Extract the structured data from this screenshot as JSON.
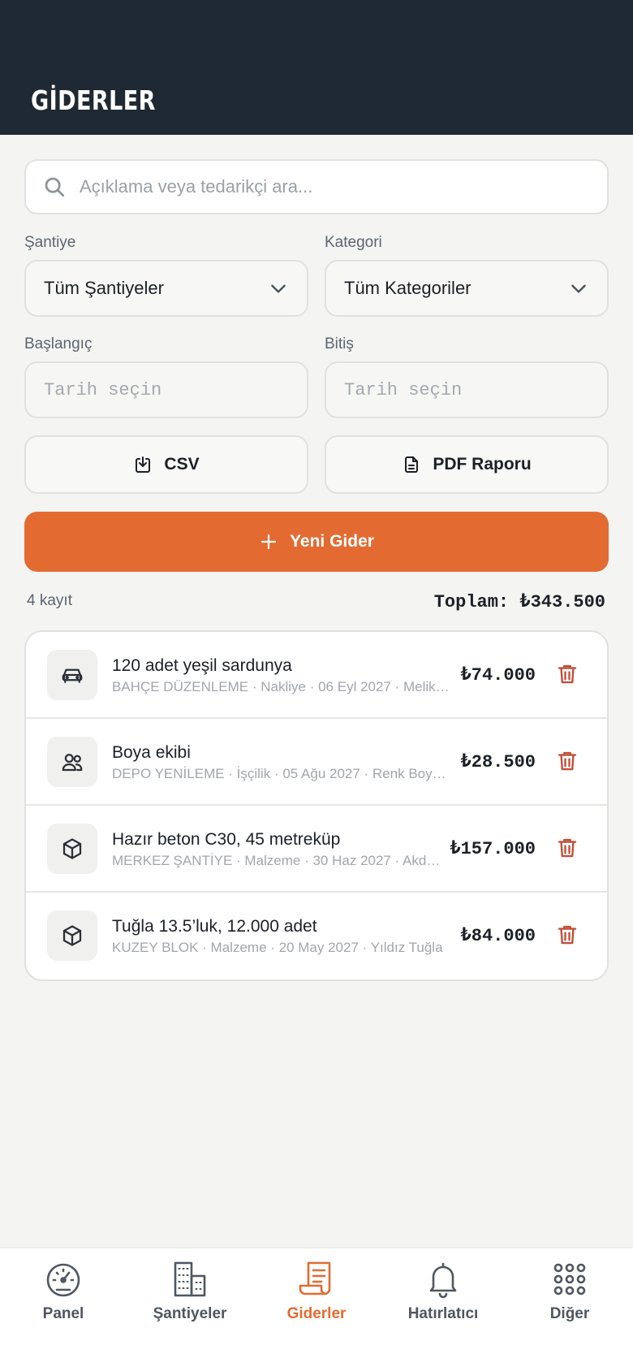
{
  "header": {
    "title": "GİDERLER"
  },
  "search": {
    "placeholder": "Açıklama veya tedarikçi ara..."
  },
  "filters": {
    "site_label": "Şantiye",
    "site_value": "Tüm Şantiyeler",
    "category_label": "Kategori",
    "category_value": "Tüm Kategoriler",
    "start_label": "Başlangıç",
    "start_placeholder": "Tarih seçin",
    "end_label": "Bitiş",
    "end_placeholder": "Tarih seçin"
  },
  "actions": {
    "csv_label": "CSV",
    "pdf_label": "PDF Raporu",
    "new_label": "Yeni Gider"
  },
  "summary": {
    "count": "4 kayıt",
    "total": "Toplam: ₺343.500"
  },
  "expenses": [
    {
      "icon": "car-icon",
      "title": "120 adet yeşil sardunya",
      "meta": "BAHÇE DÜZENLEME · Nakliye · 06 Eyl 2027 · Melik…",
      "amount": "₺74.000"
    },
    {
      "icon": "users-icon",
      "title": "Boya ekibi",
      "meta": "DEPO YENİLEME · İşçilik · 05 Ağu 2027 · Renk Boy…",
      "amount": "₺28.500"
    },
    {
      "icon": "box-icon",
      "title": "Hazır beton C30, 45 metreküp",
      "meta": "MERKEZ ŞANTİYE · Malzeme · 30 Haz 2027 · Akd…",
      "amount": "₺157.000"
    },
    {
      "icon": "box-icon",
      "title": "Tuğla 13.5’luk, 12.000 adet",
      "meta": "KUZEY BLOK · Malzeme · 20 May 2027 · Yıldız Tuğla",
      "amount": "₺84.000"
    }
  ],
  "tabs": [
    {
      "label": "Panel",
      "icon": "gauge-icon"
    },
    {
      "label": "Şantiyeler",
      "icon": "buildings-icon"
    },
    {
      "label": "Giderler",
      "icon": "receipt-icon",
      "active": true
    },
    {
      "label": "Hatırlatıcı",
      "icon": "bell-icon"
    },
    {
      "label": "Diğer",
      "icon": "grid-icon"
    }
  ],
  "colors": {
    "header": "#1f2933",
    "accent": "#e36b31",
    "danger": "#c0503a",
    "background": "#f4f4f2"
  }
}
